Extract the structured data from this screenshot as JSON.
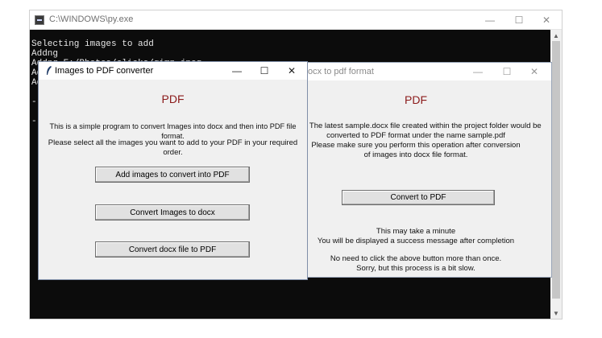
{
  "console": {
    "title": "C:\\WINDOWS\\py.exe",
    "lines": [
      "Selecting images to add",
      "Addng",
      "Addng E:/Photos/clicks/gimp.jpeg",
      "Add",
      "Ad",
      "",
      "--",
      "",
      "--"
    ],
    "controls": {
      "minimize": "—",
      "maximize": "☐",
      "close": "✕"
    },
    "scroll": {
      "up": "▲",
      "down": "▼"
    }
  },
  "converter": {
    "title": "Images to PDF converter",
    "heading": "PDF",
    "line1": "This is a simple program to convert Images into docx and then into PDF file format.",
    "line2": "Please select all the images you want to add to your PDF in your required order.",
    "buttons": {
      "add": "Add images to convert into PDF",
      "convert_docx": "Convert Images to docx",
      "convert_pdf": "Convert docx file to PDF"
    },
    "controls": {
      "minimize": "—",
      "maximize": "☐",
      "close": "✕"
    }
  },
  "docx_window": {
    "title": "ocx to pdf format",
    "heading": "PDF",
    "note_lines": [
      "note. The latest sample.docx file created within the project folder would be",
      "converted to PDF format under the name sample.pdf",
      "Please make sure you perform this operation after conversion",
      "of images into docx file format."
    ],
    "button": "Convert to PDF",
    "info_lines": [
      "This may take a minute",
      "You will be displayed a success message after completion"
    ],
    "warning_lines": [
      "No need to click the above button more than once.",
      "Sorry, but this process is a bit slow."
    ],
    "controls": {
      "minimize": "—",
      "maximize": "☐",
      "close": "✕"
    }
  }
}
